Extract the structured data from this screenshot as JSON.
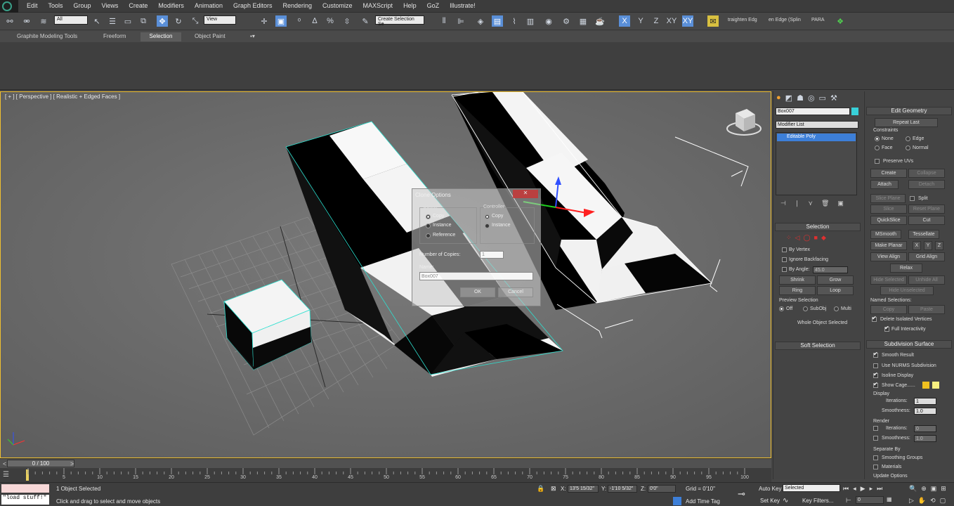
{
  "menu": [
    "Edit",
    "Tools",
    "Group",
    "Views",
    "Create",
    "Modifiers",
    "Animation",
    "Graph Editors",
    "Rendering",
    "Customize",
    "MAXScript",
    "Help",
    "GoZ",
    "Illustrate!"
  ],
  "toolbar": {
    "filter_value": "All",
    "refcoord_value": "View",
    "named_selection": "Create Selection Se",
    "btn_straighten": "traighten Edg",
    "btn_open_edge": "en Edge (Splin",
    "btn_para": "PARA",
    "xyz": [
      "X",
      "Y",
      "Z",
      "XY",
      "XY"
    ]
  },
  "ribbon": {
    "tabs": [
      "Graphite Modeling Tools",
      "Freeform",
      "Selection",
      "Object Paint"
    ],
    "active": "Selection"
  },
  "viewport": {
    "label": "[ + ] [ Perspective ] [ Realistic + Edged Faces ]"
  },
  "clone_dialog": {
    "title": "Clone Options",
    "object_group": "Object",
    "controller_group": "Controller",
    "object_options": [
      "Copy",
      "Instance",
      "Reference"
    ],
    "controller_options": [
      "Copy",
      "Instance"
    ],
    "copies_label": "Number of Copies:",
    "copies_value": "1",
    "name_label": "Name:",
    "name_value": "Box007",
    "ok": "OK",
    "cancel": "Cancel"
  },
  "command_panel": {
    "object_name": "Box007",
    "modifier_list": "Modifier List",
    "stack_item": "Editable Poly",
    "selection_title": "Selection",
    "by_vertex": "By Vertex",
    "ignore_backfacing": "Ignore Backfacing",
    "by_angle": "By Angle:",
    "angle_value": "45.0",
    "shrink": "Shrink",
    "grow": "Grow",
    "ring": "Ring",
    "loop": "Loop",
    "preview_selection": "Preview Selection",
    "preview_options": [
      "Off",
      "SubObj",
      "Multi"
    ],
    "whole_object": "Whole Object Selected",
    "soft_selection": "Soft Selection"
  },
  "edit_geometry": {
    "title": "Edit Geometry",
    "repeat_last": "Repeat Last",
    "constraints": "Constraints",
    "constraint_opts": [
      "None",
      "Edge",
      "Face",
      "Normal"
    ],
    "preserve_uvs": "Preserve UVs",
    "create": "Create",
    "collapse": "Collapse",
    "attach": "Attach",
    "detach": "Detach",
    "slice_plane": "Slice Plane",
    "split": "Split",
    "slice": "Slice",
    "reset_plane": "Reset Plane",
    "quickslice": "QuickSlice",
    "cut": "Cut",
    "msmooth": "MSmooth",
    "tessellate": "Tessellate",
    "make_planar": "Make Planar",
    "xyz": [
      "X",
      "Y",
      "Z"
    ],
    "view_align": "View Align",
    "grid_align": "Grid Align",
    "relax": "Relax",
    "hide_selected": "Hide Selected",
    "unhide_all": "Unhide All",
    "hide_unselected": "Hide Unselected",
    "named_selections": "Named Selections:",
    "copy": "Copy",
    "paste": "Paste",
    "delete_isolated": "Delete Isolated Vertices",
    "full_interactivity": "Full Interactivity"
  },
  "subdivision": {
    "title": "Subdivision Surface",
    "smooth_result": "Smooth Result",
    "use_nurms": "Use NURMS Subdivision",
    "isoline": "Isoline Display",
    "show_cage": "Show Cage......",
    "display": "Display",
    "iterations_label": "Iterations:",
    "iterations_value": "1",
    "smoothness_label": "Smoothness:",
    "smoothness_value": "1.0",
    "render": "Render",
    "r_iterations_value": "0",
    "r_smoothness_value": "1.0",
    "separate_by": "Separate By",
    "smoothing_groups": "Smoothing Groups",
    "materials": "Materials",
    "update_options": "Update Options"
  },
  "timeline": {
    "frame_display": "0 / 100",
    "ticks": [
      "0",
      "5",
      "10",
      "15",
      "20",
      "25",
      "30",
      "35",
      "40",
      "45",
      "50",
      "55",
      "60",
      "65",
      "70",
      "75",
      "80",
      "85",
      "90",
      "95",
      "100"
    ]
  },
  "status": {
    "script_text": "\"load stuff!\"",
    "selected_text": "1 Object Selected",
    "prompt": "Click and drag to select and move objects",
    "x_value": "13'5 15/32\"",
    "y_value": "-1'10 5/32\"",
    "z_value": "0'0\"",
    "grid": "Grid = 0'10\"",
    "add_time_tag": "Add Time Tag",
    "auto_key": "Auto Key",
    "selected_dropdown": "Selected",
    "set_key": "Set Key",
    "key_filters": "Key Filters...",
    "frame_value": "0"
  },
  "colors": {
    "accent": "#f0c030",
    "viewport_bg": "#6e6e6e",
    "stack_highlight": "#3d7fd8"
  }
}
